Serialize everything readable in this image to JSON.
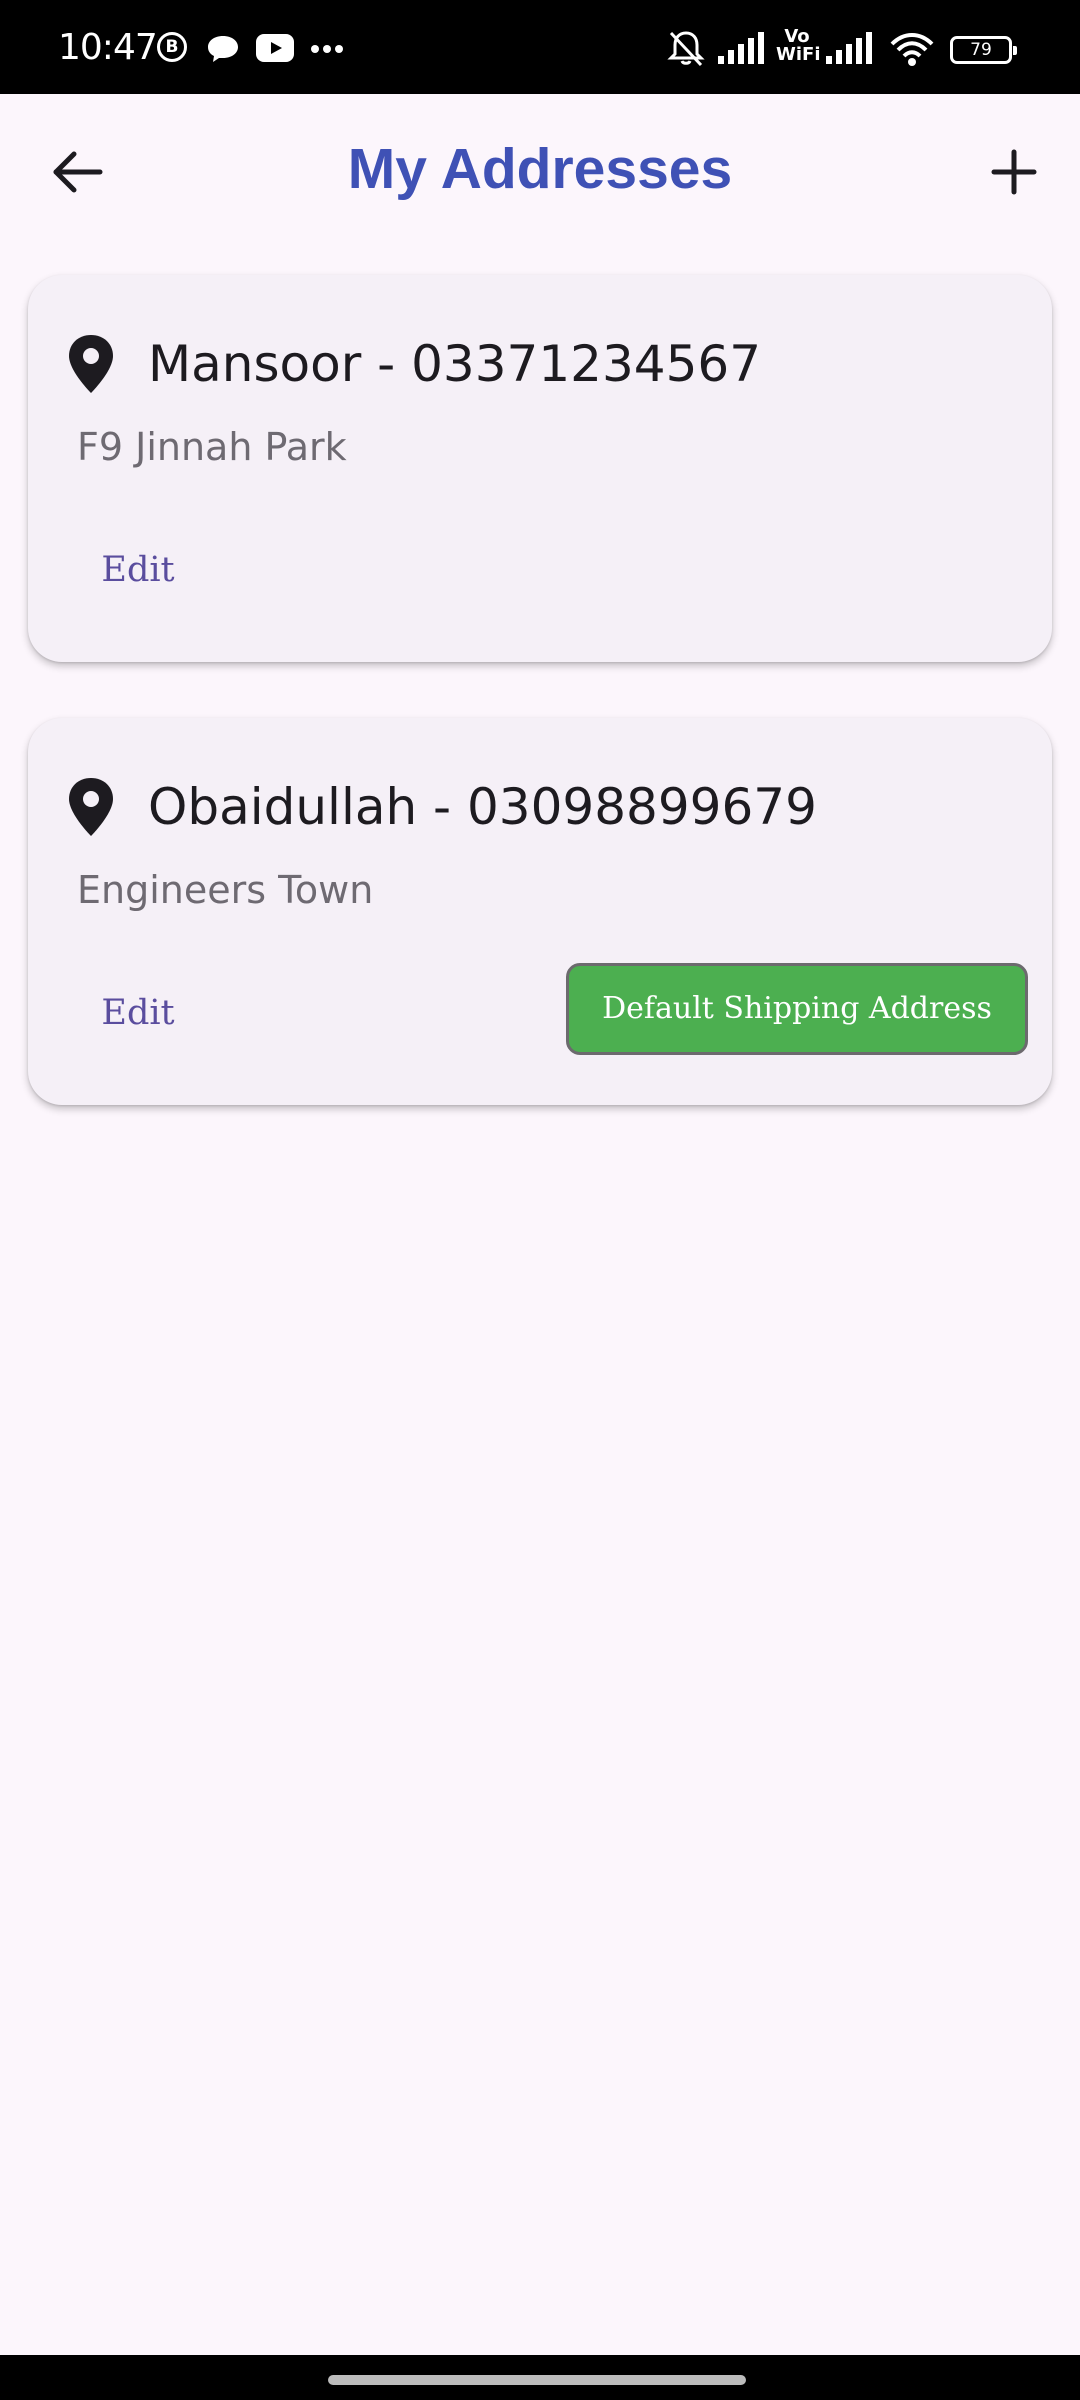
{
  "status_bar": {
    "time": "10:47",
    "icons": [
      "b-badge-icon",
      "chat-bubble-icon",
      "youtube-icon",
      "more-dots-icon",
      "bell-muted-icon",
      "signal-icon",
      "vowifi-icon",
      "signal-icon",
      "wifi-icon",
      "battery-icon"
    ],
    "vowifi_line1": "Vo",
    "vowifi_line2": "WiFi",
    "battery_level": "79"
  },
  "header": {
    "title": "My Addresses",
    "back_icon": "arrow-left-icon",
    "add_icon": "plus-icon"
  },
  "addresses": [
    {
      "title": "Mansoor - 03371234567",
      "address": "F9 Jinnah Park",
      "edit_label": "Edit"
    },
    {
      "title": "Obaidullah - 03098899679",
      "address": "Engineers Town",
      "edit_label": "Edit",
      "default_label": "Default Shipping Address"
    }
  ],
  "colors": {
    "accent": "#3f51b5",
    "default_button": "#4caf50",
    "edit_text": "#5a4d9e",
    "background": "#fcf6fc",
    "card": "#f5f0f7"
  }
}
